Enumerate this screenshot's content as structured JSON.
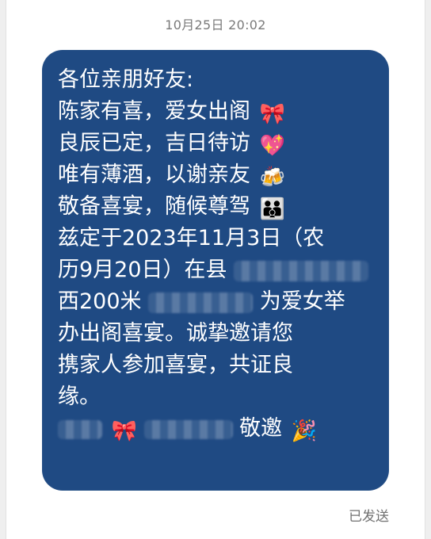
{
  "timestamp": "10月25日 20:02",
  "status": "已发送",
  "message": {
    "lines": [
      "各位亲朋好友:",
      "陈家有喜，爱女出阁",
      "良辰已定，吉日待访",
      "唯有薄酒，以谢亲友",
      "敬备喜宴，随候尊驾",
      "兹定于2023年11月3日（农",
      "历9月20日）在县",
      "西200米",
      "为爱女举",
      "办出阁喜宴。诚挚邀请您",
      "携家人参加喜宴，共证良",
      "缘。",
      "敬邀"
    ],
    "emojis": {
      "bow": "🎀",
      "sparkling_heart": "💖",
      "beer_mugs": "🍻",
      "family": "👪",
      "party_popper": "🎉"
    }
  },
  "colors": {
    "bubble": "#1f4a83",
    "text": "#ffffff",
    "timestamp": "#7a7a7a",
    "status": "#707070"
  }
}
